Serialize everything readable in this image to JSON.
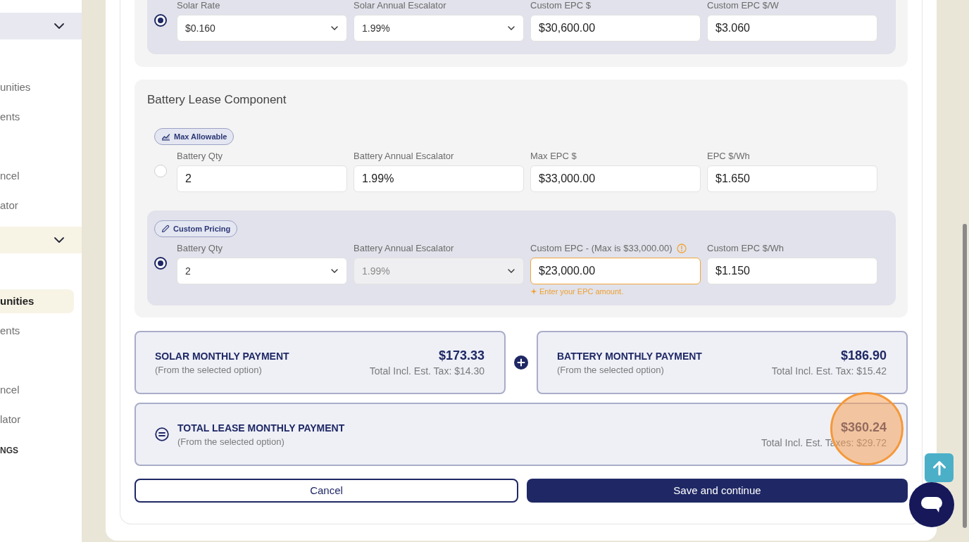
{
  "sidebar": {
    "sections": [
      {
        "expanded": true,
        "items": [
          {
            "label": "unities",
            "selected": false
          },
          {
            "label": "ents",
            "selected": false
          },
          {
            "label": "ncel",
            "selected": false
          },
          {
            "label": "ator",
            "selected": false
          }
        ]
      },
      {
        "expanded": true,
        "items": [
          {
            "label": "unities",
            "selected": true
          },
          {
            "label": "ents",
            "selected": false
          },
          {
            "label": "ncel",
            "selected": false
          },
          {
            "label": "lator",
            "selected": false
          }
        ]
      }
    ],
    "footer_label": "NGS"
  },
  "solar_option": {
    "selected": true,
    "fields": [
      {
        "label": "Solar Rate",
        "value": "$0.160",
        "kind": "select",
        "disabled": false,
        "highlighted": false
      },
      {
        "label": "Solar Annual Escalator",
        "value": "1.99%",
        "kind": "select",
        "disabled": false,
        "highlighted": false
      },
      {
        "label": "Custom EPC $",
        "value": "$30,600.00",
        "kind": "input",
        "disabled": false,
        "highlighted": false
      },
      {
        "label": "Custom EPC $/W",
        "value": "$3.060",
        "kind": "input",
        "disabled": false,
        "highlighted": false
      }
    ]
  },
  "battery_lease": {
    "title": "Battery Lease Component",
    "options": [
      {
        "kind": "max_allowable",
        "badge": "Max Allowable",
        "selected": false,
        "fields": [
          {
            "label": "Battery Qty",
            "value": "2",
            "kind": "input",
            "disabled": false,
            "highlighted": false
          },
          {
            "label": "Battery Annual Escalator",
            "value": "1.99%",
            "kind": "input",
            "disabled": false,
            "highlighted": false
          },
          {
            "label": "Max EPC $",
            "value": "$33,000.00",
            "kind": "input",
            "disabled": false,
            "highlighted": false
          },
          {
            "label": "EPC $/Wh",
            "value": "$1.650",
            "kind": "input",
            "disabled": false,
            "highlighted": false
          }
        ]
      },
      {
        "kind": "custom_pricing",
        "badge": "Custom Pricing",
        "selected": true,
        "fields": [
          {
            "label": "Battery Qty",
            "value": "2",
            "kind": "select",
            "disabled": false,
            "highlighted": false
          },
          {
            "label": "Battery Annual Escalator",
            "value": "1.99%",
            "kind": "select",
            "disabled": true,
            "highlighted": false
          },
          {
            "label": "Custom EPC - (Max is $33,000.00)",
            "value": "$23,000.00",
            "kind": "input",
            "disabled": false,
            "highlighted": true,
            "hint": "Enter your EPC amount."
          },
          {
            "label": "Custom EPC $/Wh",
            "value": "$1.150",
            "kind": "input",
            "disabled": false,
            "highlighted": false
          }
        ]
      }
    ]
  },
  "payments": [
    {
      "title": "SOLAR MONTHLY PAYMENT",
      "subtitle": "(From the selected option)",
      "amount": "$173.33",
      "tax": "Total Incl. Est. Tax: $14.30"
    },
    {
      "title": "BATTERY MONTHLY PAYMENT",
      "subtitle": "(From the selected option)",
      "amount": "$186.90",
      "tax": "Total Incl. Est. Tax: $15.42"
    }
  ],
  "total": {
    "title": "TOTAL LEASE MONTHLY PAYMENT",
    "subtitle": "(From the selected option)",
    "amount": "$360.24",
    "tax": "Total Incl. Est. Taxes: $29.72"
  },
  "buttons": [
    {
      "label": "Cancel",
      "kind": "secondary"
    },
    {
      "label": "Save and continue",
      "kind": "primary"
    }
  ]
}
